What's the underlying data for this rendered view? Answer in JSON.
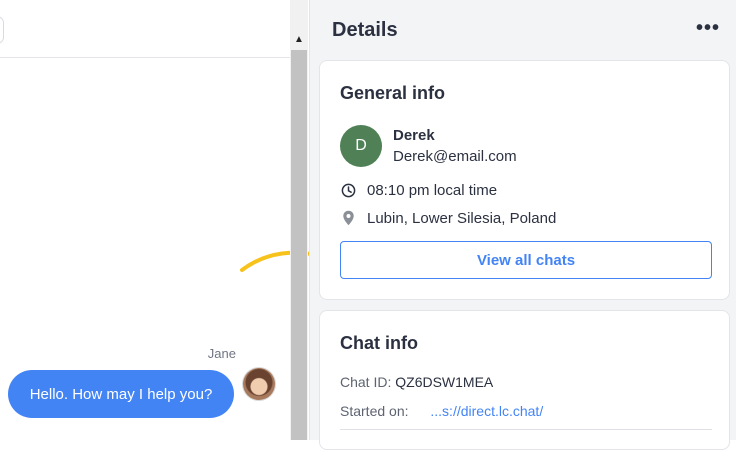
{
  "chat": {
    "sender_name": "Jane",
    "message": "Hello. How may I help you?"
  },
  "details": {
    "title": "Details",
    "more_icon": "more-horizontal-icon",
    "general_info": {
      "title": "General info",
      "avatar_initial": "D",
      "avatar_color": "#4f8056",
      "name": "Derek",
      "email": "Derek@email.com",
      "local_time": "08:10 pm local time",
      "location": "Lubin, Lower Silesia, Poland",
      "view_all_button": "View all chats"
    },
    "chat_info": {
      "title": "Chat info",
      "chat_id_label": "Chat ID:",
      "chat_id_value": "QZ6DSW1MEA",
      "started_on_label": "Started on:",
      "started_on_value": "...s://direct.lc.chat/"
    }
  },
  "colors": {
    "accent": "#4384f5",
    "highlight_arrow": "#f7c21b",
    "panel_bg": "#f3f4f6"
  }
}
